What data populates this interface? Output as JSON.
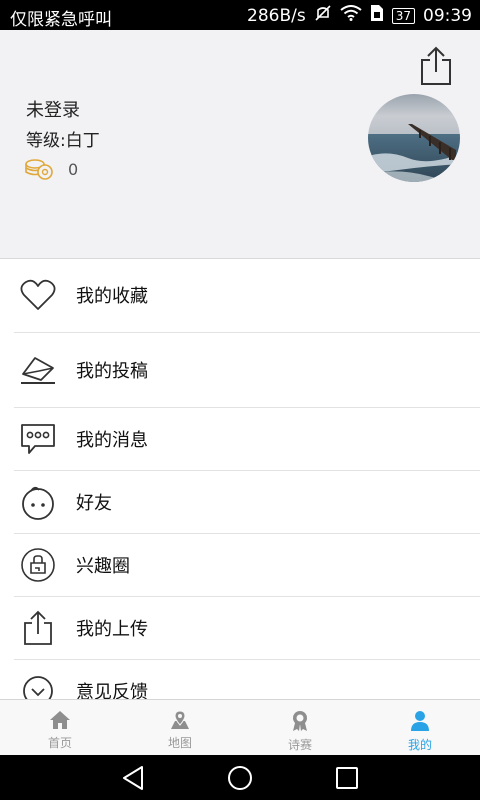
{
  "status_bar": {
    "carrier": "仅限紧急呼叫",
    "speed": "286B/s",
    "battery": "37",
    "time": "09:39"
  },
  "profile": {
    "name": "未登录",
    "level": "等级:白丁",
    "coins": "0"
  },
  "menu": [
    {
      "label": "我的收藏",
      "icon": "heart-icon"
    },
    {
      "label": "我的投稿",
      "icon": "envelope-icon"
    },
    {
      "label": "我的消息",
      "icon": "message-icon"
    },
    {
      "label": "好友",
      "icon": "friend-face-icon"
    },
    {
      "label": "兴趣圈",
      "icon": "interest-circle-icon"
    },
    {
      "label": "我的上传",
      "icon": "upload-icon"
    },
    {
      "label": "意见反馈",
      "icon": "feedback-icon"
    }
  ],
  "tabs": [
    {
      "label": "首页",
      "icon": "home-icon",
      "active": false
    },
    {
      "label": "地图",
      "icon": "map-icon",
      "active": false
    },
    {
      "label": "诗赛",
      "icon": "award-icon",
      "active": false
    },
    {
      "label": "我的",
      "icon": "person-icon",
      "active": true
    }
  ],
  "colors": {
    "accent": "#29a3e6",
    "profile_bg": "#f2f2f4",
    "coin": "#e0a83a"
  }
}
